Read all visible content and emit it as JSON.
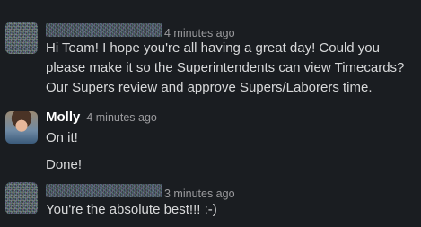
{
  "messages": [
    {
      "author": "",
      "time": "4 minutes ago",
      "lines": [
        "Hi Team! I hope you're all having a great day! Could you",
        "please make it so the Superintendents can view Timecards?",
        "Our Supers review and approve Supers/Laborers time."
      ]
    },
    {
      "author": "Molly",
      "time": "4 minutes ago",
      "lines": [
        "On it!",
        "Done!"
      ]
    },
    {
      "author": "",
      "time": "3 minutes ago",
      "lines": [
        "You're the absolute best!!! :-)"
      ]
    }
  ]
}
